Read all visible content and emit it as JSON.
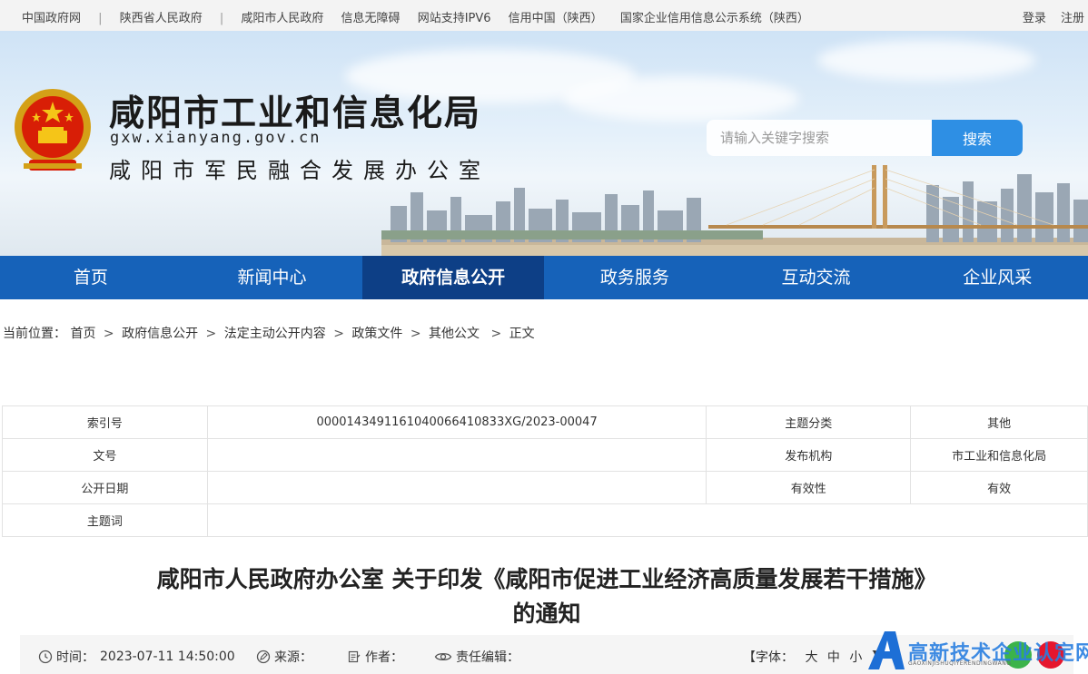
{
  "topbar": {
    "links": [
      "中国政府网",
      "陕西省人民政府",
      "咸阳市人民政府",
      "信息无障碍",
      "网站支持IPV6",
      "信用中国（陕西）",
      "国家企业信用信息公示系统（陕西）"
    ],
    "login": "登录",
    "register": "注册"
  },
  "header": {
    "title": "咸阳市工业和信息化局",
    "domain": "gxw.xianyang.gov.cn",
    "subtitle": "咸阳市军民融合发展办公室",
    "search_placeholder": "请输入关键字搜索",
    "search_button": "搜索"
  },
  "nav": {
    "items": [
      "首页",
      "新闻中心",
      "政府信息公开",
      "政务服务",
      "互动交流",
      "企业风采"
    ],
    "active_index": 2
  },
  "breadcrumb": {
    "prefix": "当前位置：",
    "items": [
      "首页",
      "政府信息公开",
      "法定主动公开内容",
      "政策文件",
      "其他公文",
      "正文"
    ]
  },
  "info_table": {
    "index_label": "索引号",
    "index_value": "000014349116104006641083 3XG/2023-00047",
    "topic_label": "主题分类",
    "topic_value": "其他",
    "docno_label": "文号",
    "docno_value": "",
    "org_label": "发布机构",
    "org_value": "市工业和信息化局",
    "date_label": "公开日期",
    "date_value": "",
    "validity_label": "有效性",
    "validity_value": "有效",
    "keywords_label": "主题词",
    "keywords_value": ""
  },
  "article": {
    "title_line1": "咸阳市人民政府办公室 关于印发《咸阳市促进工业经济高质量发展若干措施》",
    "title_line2": "的通知"
  },
  "meta": {
    "time_label": "时间：",
    "time_value": "2023-07-11 14:50:00",
    "source_label": "来源：",
    "author_label": "作者：",
    "editor_label": "责任编辑：",
    "font_label": "【字体：",
    "font_big": "大",
    "font_mid": "中",
    "font_small": "小",
    "font_close": "】"
  },
  "watermark": {
    "text": "高新技术企业认定网",
    "small": "GAOXINJISHUQIYERENDINGWANG"
  },
  "colors": {
    "nav_bg": "#1662b9",
    "nav_active": "#0d3f86",
    "search_button": "#2e8fe4"
  }
}
